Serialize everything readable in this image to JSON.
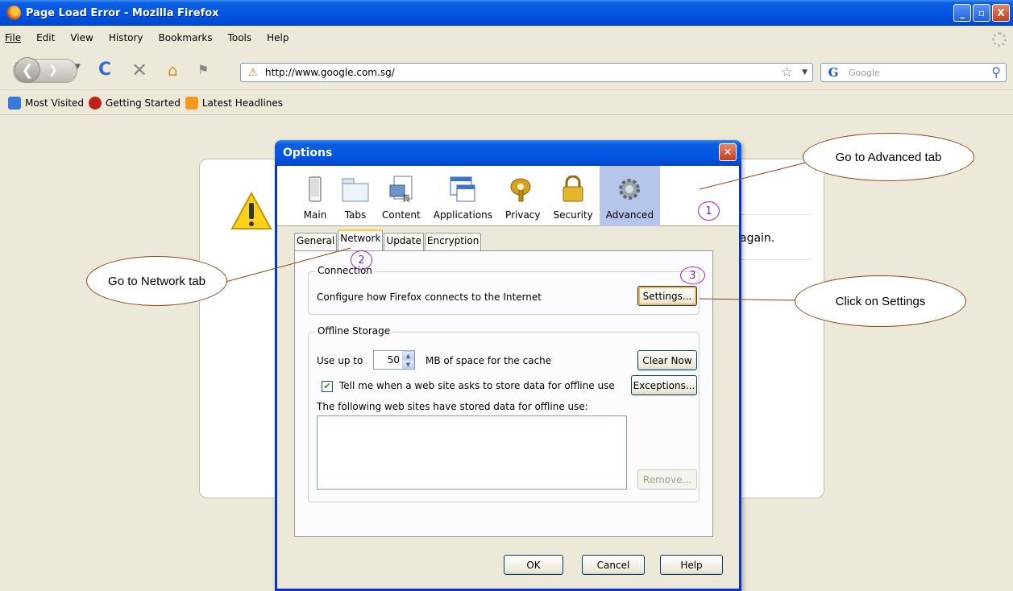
{
  "window": {
    "title": "Page Load Error - Mozilla Firefox",
    "buttons": {
      "minimize": "_",
      "maximize": "▫",
      "close": "X"
    }
  },
  "menu": [
    "File",
    "Edit",
    "View",
    "History",
    "Bookmarks",
    "Tools",
    "Help"
  ],
  "navbar": {
    "url": "http://www.google.com.sg/",
    "search_placeholder": "Google",
    "search_engine": "G"
  },
  "bookmarks": [
    "Most Visited",
    "Getting Started",
    "Latest Headlines"
  ],
  "error_page": {
    "text": "again."
  },
  "dialog": {
    "title": "Options",
    "panes": [
      {
        "label": "Main",
        "icon": "main-pane-icon"
      },
      {
        "label": "Tabs",
        "icon": "tabs-pane-icon"
      },
      {
        "label": "Content",
        "icon": "content-pane-icon"
      },
      {
        "label": "Applications",
        "icon": "applications-pane-icon"
      },
      {
        "label": "Privacy",
        "icon": "privacy-pane-icon"
      },
      {
        "label": "Security",
        "icon": "security-pane-icon"
      },
      {
        "label": "Advanced",
        "icon": "advanced-pane-icon"
      }
    ],
    "selected_pane": "Advanced",
    "subtabs": [
      "General",
      "Network",
      "Update",
      "Encryption"
    ],
    "active_subtab": "Network",
    "connection": {
      "label": "Connection",
      "description": "Configure how Firefox connects to the Internet",
      "settings_button": "Settings..."
    },
    "offline": {
      "label": "Offline Storage",
      "use_up_to": "Use up to",
      "cache_value": "50",
      "cache_suffix": "MB of space for the cache",
      "clear_now": "Clear Now",
      "tell_me": "Tell me when a web site asks to store data for offline use",
      "tell_me_checked": true,
      "exceptions": "Exceptions...",
      "list_label": "The following web sites have stored data for offline use:",
      "remove": "Remove..."
    },
    "buttons": {
      "ok": "OK",
      "cancel": "Cancel",
      "help": "Help"
    }
  },
  "annotations": {
    "advanced": "Go to Advanced tab",
    "network": "Go to Network tab",
    "settings": "Click on Settings",
    "step1": "1",
    "step2": "2",
    "step3": "3"
  },
  "colors": {
    "xp_title_blue": "#0054e3",
    "dialog_border": "#0831d9",
    "annotation_line": "#8b4513",
    "annotation_number": "#a020f0",
    "selected_pane": "#b6c5ea"
  }
}
